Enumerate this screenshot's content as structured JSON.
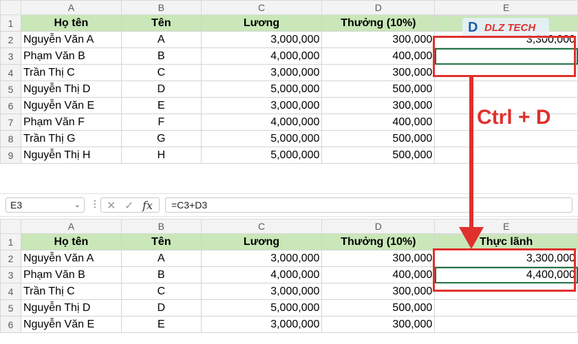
{
  "columns": [
    "A",
    "B",
    "C",
    "D",
    "E"
  ],
  "headers": {
    "ho_ten": "Họ tên",
    "ten": "Tên",
    "luong": "Lương",
    "thuong": "Thưởng (10%)",
    "thuc_lanh": "Thực lãnh"
  },
  "rows_top": [
    {
      "num": "2",
      "name": "Nguyễn Văn A",
      "short": "A",
      "salary": "3,000,000",
      "bonus": "300,000",
      "total": "3,300,000"
    },
    {
      "num": "3",
      "name": "Phạm Văn B",
      "short": "B",
      "salary": "4,000,000",
      "bonus": "400,000",
      "total": ""
    },
    {
      "num": "4",
      "name": "Trần Thị C",
      "short": "C",
      "salary": "3,000,000",
      "bonus": "300,000",
      "total": ""
    },
    {
      "num": "5",
      "name": "Nguyễn Thị D",
      "short": "D",
      "salary": "5,000,000",
      "bonus": "500,000",
      "total": ""
    },
    {
      "num": "6",
      "name": "Nguyễn Văn E",
      "short": "E",
      "salary": "3,000,000",
      "bonus": "300,000",
      "total": ""
    },
    {
      "num": "7",
      "name": "Phạm Văn F",
      "short": "F",
      "salary": "4,000,000",
      "bonus": "400,000",
      "total": ""
    },
    {
      "num": "8",
      "name": "Trần Thị G",
      "short": "G",
      "salary": "5,000,000",
      "bonus": "500,000",
      "total": ""
    },
    {
      "num": "9",
      "name": "Nguyễn Thị H",
      "short": "H",
      "salary": "5,000,000",
      "bonus": "500,000",
      "total": ""
    }
  ],
  "rows_bottom": [
    {
      "num": "2",
      "name": "Nguyễn Văn A",
      "short": "A",
      "salary": "3,000,000",
      "bonus": "300,000",
      "total": "3,300,000"
    },
    {
      "num": "3",
      "name": "Phạm Văn B",
      "short": "B",
      "salary": "4,000,000",
      "bonus": "400,000",
      "total": "4,400,000"
    },
    {
      "num": "4",
      "name": "Trần Thị C",
      "short": "C",
      "salary": "3,000,000",
      "bonus": "300,000",
      "total": ""
    },
    {
      "num": "5",
      "name": "Nguyễn Thị D",
      "short": "D",
      "salary": "5,000,000",
      "bonus": "500,000",
      "total": ""
    },
    {
      "num": "6",
      "name": "Nguyễn Văn E",
      "short": "E",
      "salary": "3,000,000",
      "bonus": "300,000",
      "total": ""
    }
  ],
  "formula_bar": {
    "name_box": "E3",
    "formula": "=C3+D3",
    "fx_label": "fx"
  },
  "annotation": "Ctrl + D",
  "logo": {
    "mark": "D",
    "text": "DLZ TECH"
  },
  "colors": {
    "header_fill": "#c9e7b8",
    "highlight_red": "#e0302c",
    "excel_green": "#217346"
  }
}
